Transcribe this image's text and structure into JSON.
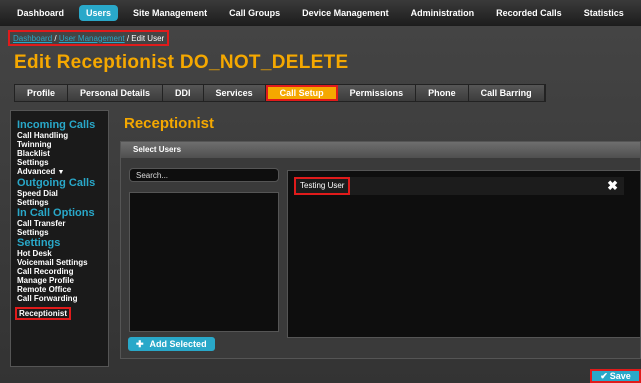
{
  "topnav": {
    "items": [
      "Dashboard",
      "Users",
      "Site Management",
      "Call Groups",
      "Device Management",
      "Administration",
      "Recorded Calls",
      "Statistics"
    ],
    "active_index": 1
  },
  "breadcrumb": {
    "link1": "Dashboard",
    "sep1": " / ",
    "link2": "User Management",
    "sep2": " / ",
    "current": "Edit User"
  },
  "page_title": "Edit Receptionist DO_NOT_DELETE",
  "tabs": {
    "items": [
      "Profile",
      "Personal Details",
      "DDI",
      "Services",
      "Call Setup",
      "Permissions",
      "Phone",
      "Call Barring"
    ],
    "active_index": 4
  },
  "sidebar": {
    "incoming_title": "Incoming Calls",
    "incoming_items": [
      "Call Handling",
      "Twinning",
      "Blacklist",
      "Settings",
      "Advanced"
    ],
    "outgoing_title": "Outgoing Calls",
    "outgoing_items": [
      "Speed Dial",
      "Settings"
    ],
    "incall_title": "In Call Options",
    "incall_items": [
      "Call Transfer",
      "Settings"
    ],
    "settings_title": "Settings",
    "settings_items": [
      "Hot Desk",
      "Voicemail Settings",
      "Call Recording",
      "Manage Profile",
      "Remote Office",
      "Call Forwarding",
      "Receptionist"
    ]
  },
  "main": {
    "title": "Receptionist",
    "panel_title": "Select Users",
    "search_placeholder": "Search...",
    "selected_user": "Testing User",
    "add_button": "Add Selected",
    "save_button": "Save"
  },
  "colors": {
    "accent": "#29a8c9",
    "title": "#f5a800",
    "highlight": "#e01b1b"
  }
}
